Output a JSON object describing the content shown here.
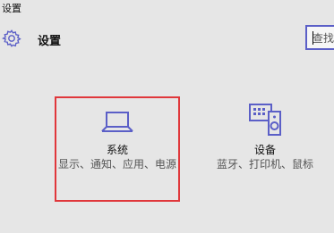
{
  "window": {
    "title": "设置"
  },
  "header": {
    "icon": "gear-icon",
    "title": "设置"
  },
  "search": {
    "value": "查找"
  },
  "tiles": [
    {
      "icon": "laptop-icon",
      "name": "系统",
      "description": "显示、通知、应用、电源"
    },
    {
      "icon": "devices-icon",
      "name": "设备",
      "description": "蓝牙、打印机、鼠标"
    }
  ],
  "colors": {
    "accent": "#5b5fc7",
    "highlight_border": "#e0373b",
    "background": "#e6e6e6"
  }
}
